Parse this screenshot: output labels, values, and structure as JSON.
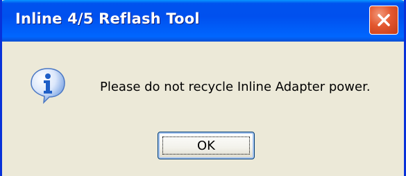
{
  "window": {
    "title": "Inline 4/5 Reflash Tool",
    "close_icon": "close-icon"
  },
  "dialog": {
    "icon": "info-icon",
    "message": "Please do not recycle Inline Adapter power.",
    "ok_label": "OK"
  },
  "colors": {
    "titlebar": "#0050ee",
    "border": "#0831d9",
    "body": "#ece9d8",
    "close_button": "#e3572f",
    "info_icon": "#2a6fd6"
  }
}
